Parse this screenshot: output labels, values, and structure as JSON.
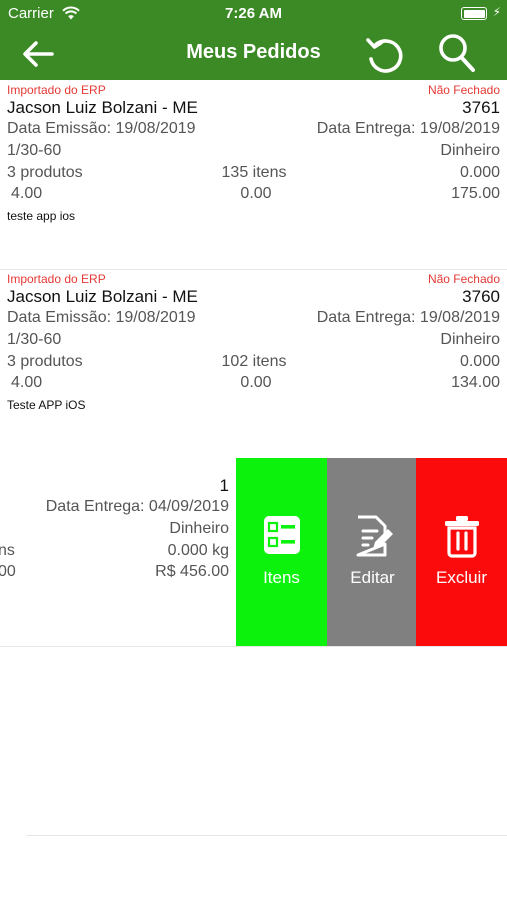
{
  "status_bar": {
    "carrier": "Carrier",
    "time": "7:26 AM"
  },
  "nav": {
    "title": "Meus Pedidos"
  },
  "orders": [
    {
      "origin": "Importado do ERP",
      "status": "Não Fechado",
      "client": "Jacson Luiz Bolzani - ME",
      "number": "3761",
      "emission": "Data Emissão: 19/08/2019",
      "delivery": "Data Entrega: 19/08/2019",
      "terms": "1/30-60",
      "payment": "Dinheiro",
      "products": "3 produtos",
      "items": "135 itens",
      "weight": "0.000",
      "v1": "4.00",
      "v2": "0.00",
      "total": "175.00",
      "note": "teste app ios"
    },
    {
      "origin": "Importado do ERP",
      "status": "Não Fechado",
      "client": "Jacson Luiz Bolzani - ME",
      "number": "3760",
      "emission": "Data Emissão: 19/08/2019",
      "delivery": "Data Entrega: 19/08/2019",
      "terms": "1/30-60",
      "payment": "Dinheiro",
      "products": "3 produtos",
      "items": "102 itens",
      "weight": "0.000",
      "v1": "4.00",
      "v2": "0.00",
      "total": "134.00",
      "note": "Teste APP iOS"
    }
  ],
  "swiped_order": {
    "number": "1",
    "delivery": "Data Entrega: 04/09/2019",
    "payment": "Dinheiro",
    "items_partial": "ns",
    "weight": "0.000 kg",
    "v_partial": "00",
    "total": "R$ 456.00"
  },
  "swipe_actions": {
    "itens": "Itens",
    "editar": "Editar",
    "excluir": "Excluir"
  },
  "colors": {
    "nav_bg": "#3b8a25",
    "itens_bg": "#0df20d",
    "editar_bg": "#808080",
    "excluir_bg": "#fb0b0b",
    "status_red": "#e53935"
  }
}
